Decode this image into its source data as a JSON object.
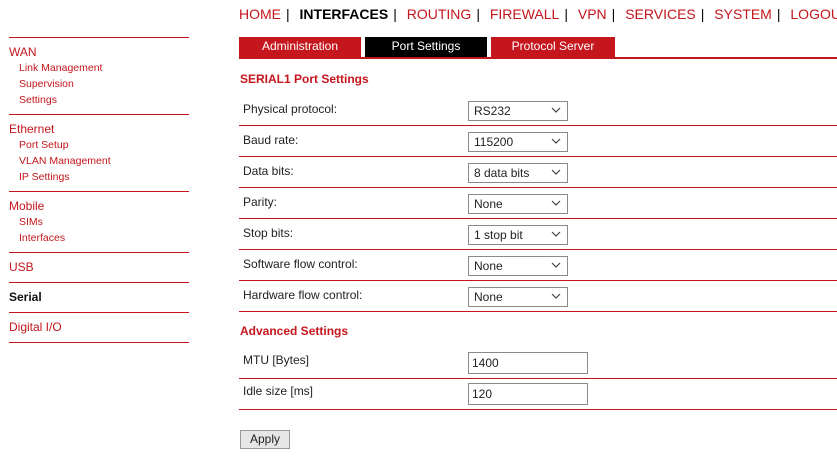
{
  "topnav": {
    "items": [
      "HOME",
      "INTERFACES",
      "ROUTING",
      "FIREWALL",
      "VPN",
      "SERVICES",
      "SYSTEM",
      "LOGOUT"
    ],
    "active": "INTERFACES",
    "separator": "|"
  },
  "sidebar": {
    "wan": {
      "label": "WAN",
      "items": [
        "Link Management",
        "Supervision",
        "Settings"
      ]
    },
    "ethernet": {
      "label": "Ethernet",
      "items": [
        "Port Setup",
        "VLAN Management",
        "IP Settings"
      ]
    },
    "mobile": {
      "label": "Mobile",
      "items": [
        "SIMs",
        "Interfaces"
      ]
    },
    "usb": {
      "label": "USB"
    },
    "serial": {
      "label": "Serial"
    },
    "digital_io": {
      "label": "Digital I/O"
    }
  },
  "tabs": [
    "Administration",
    "Port Settings",
    "Protocol Server"
  ],
  "active_tab": "Port Settings",
  "port_settings": {
    "title": "SERIAL1 Port Settings",
    "rows": [
      {
        "label": "Physical protocol:",
        "value": "RS232"
      },
      {
        "label": "Baud rate:",
        "value": "115200"
      },
      {
        "label": "Data bits:",
        "value": "8 data bits"
      },
      {
        "label": "Parity:",
        "value": "None"
      },
      {
        "label": "Stop bits:",
        "value": "1 stop bit"
      },
      {
        "label": "Software flow control:",
        "value": "None"
      },
      {
        "label": "Hardware flow control:",
        "value": "None"
      }
    ]
  },
  "advanced": {
    "title": "Advanced Settings",
    "mtu": {
      "label": "MTU [Bytes]",
      "value": "1400"
    },
    "idle": {
      "label": "Idle size [ms]",
      "value": "120"
    }
  },
  "apply_label": "Apply",
  "colors": {
    "accent": "#c4161c",
    "active_tab": "#000000"
  }
}
